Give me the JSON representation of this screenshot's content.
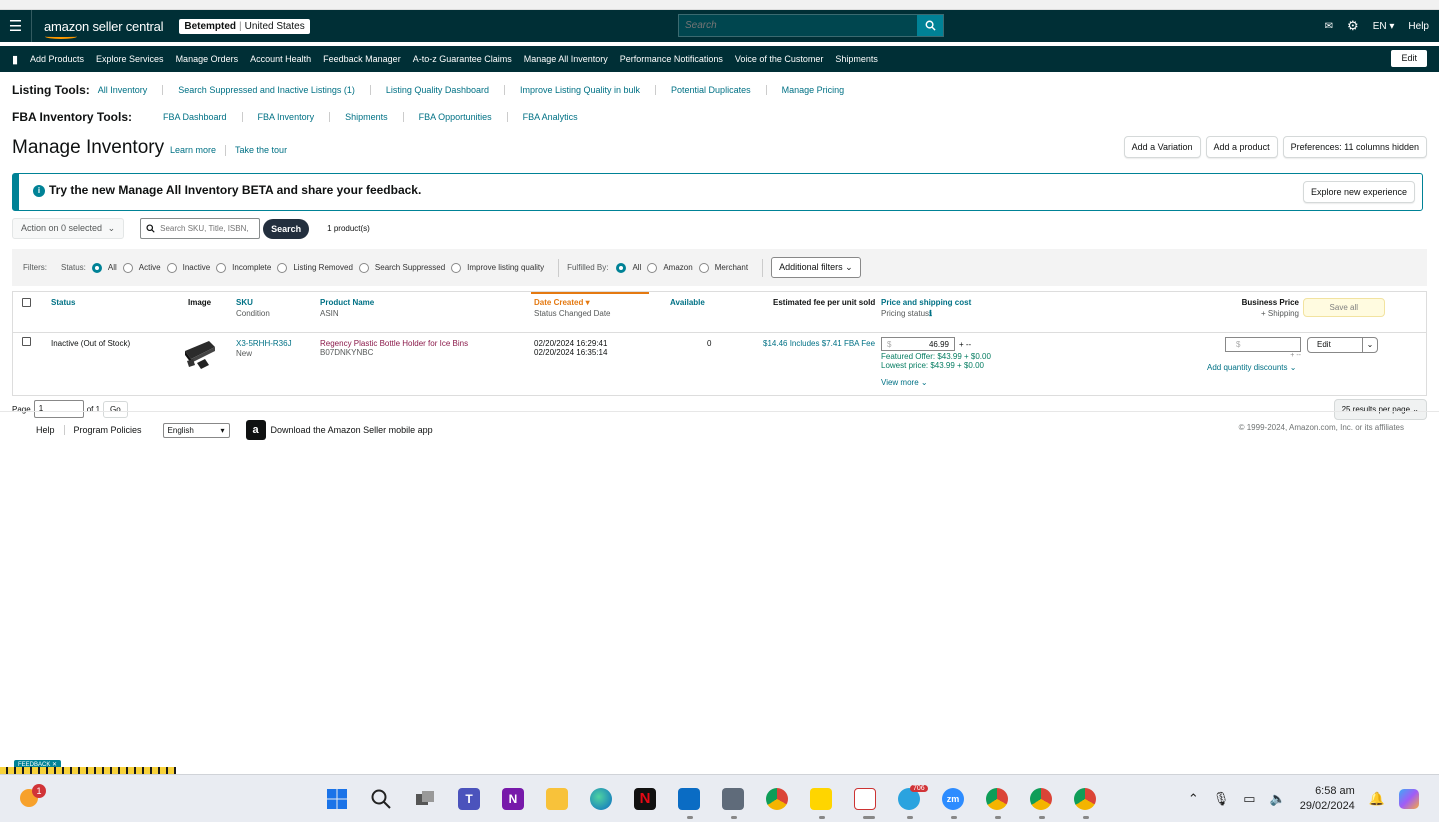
{
  "topbar": {
    "logo": "amazon seller central",
    "store_name": "Betempted",
    "store_region": "United States",
    "search_placeholder": "Search",
    "lang": "EN",
    "help": "Help"
  },
  "nav": {
    "items": [
      "Add Products",
      "Explore Services",
      "Manage Orders",
      "Account Health",
      "Feedback Manager",
      "A-to-z Guarantee Claims",
      "Manage All Inventory",
      "Performance Notifications",
      "Voice of the Customer",
      "Shipments"
    ],
    "edit": "Edit"
  },
  "listing_tools": {
    "title": "Listing Tools:",
    "links": [
      "All Inventory",
      "Search Suppressed and Inactive Listings (1)",
      "Listing Quality Dashboard",
      "Improve Listing Quality in bulk",
      "Potential Duplicates",
      "Manage Pricing"
    ]
  },
  "fba_tools": {
    "title": "FBA Inventory Tools:",
    "links": [
      "FBA Dashboard",
      "FBA Inventory",
      "Shipments",
      "FBA Opportunities",
      "FBA Analytics"
    ]
  },
  "page": {
    "title": "Manage Inventory",
    "learn_more": "Learn more",
    "take_tour": "Take the tour",
    "add_variation": "Add a Variation",
    "add_product": "Add a product",
    "preferences": "Preferences: 11 columns hidden"
  },
  "banner": {
    "icon": "i",
    "text": "Try the new Manage All Inventory BETA and share your feedback.",
    "button": "Explore new experience"
  },
  "actions": {
    "action_select": "Action on 0 selected",
    "search_placeholder": "Search SKU, Title, ISBN,",
    "search_button": "Search",
    "product_count": "1 product(s)"
  },
  "filters": {
    "label": "Filters:",
    "status_label": "Status:",
    "status_options": [
      "All",
      "Active",
      "Inactive",
      "Incomplete",
      "Listing Removed",
      "Search Suppressed",
      "Improve listing quality"
    ],
    "status_selected": "All",
    "fulfilled_label": "Fulfilled By:",
    "fulfilled_options": [
      "All",
      "Amazon",
      "Merchant"
    ],
    "fulfilled_selected": "All",
    "additional": "Additional filters"
  },
  "table": {
    "headers": {
      "status": "Status",
      "image": "Image",
      "sku": "SKU",
      "sku_sub": "Condition",
      "product_name": "Product Name",
      "product_sub": "ASIN",
      "date_created": "Date Created",
      "date_sub": "Status Changed Date",
      "available": "Available",
      "est_fee": "Estimated fee per unit sold",
      "price": "Price and shipping cost",
      "price_sub": "Pricing status",
      "business_price": "Business Price",
      "business_sub": "+ Shipping",
      "save_all": "Save all"
    },
    "rows": [
      {
        "status": "Inactive (Out of Stock)",
        "sku": "X3-5RHH-R36J",
        "condition": "New",
        "product_name": "Regency Plastic Bottle Holder for Ice Bins",
        "asin": "B07DNKYNBC",
        "date_created": "02/20/2024 16:29:41",
        "status_changed": "02/20/2024 16:35:14",
        "available": "0",
        "est_fee": "$14.46 Includes $7.41 FBA Fee",
        "price": "46.99",
        "price_currency": "$",
        "price_plus": "+ --",
        "featured_offer": "Featured Offer: $43.99 + $0.00",
        "lowest_price": "Lowest price: $43.99 + $0.00",
        "view_more": "View more",
        "business_currency": "$",
        "business_plus": "+ --",
        "add_quantity_discounts": "Add quantity discounts",
        "edit": "Edit"
      }
    ]
  },
  "pagination": {
    "page_label": "Page",
    "page_value": "1",
    "of_label": "of 1",
    "go": "Go",
    "results_per_page": "25 results per page"
  },
  "footer": {
    "help": "Help",
    "program_policies": "Program Policies",
    "language": "English",
    "app_icon": "a",
    "app_text": "Download the Amazon Seller mobile app",
    "copyright": "© 1999-2024, Amazon.com, Inc. or its affiliates"
  },
  "feedback": "FEEDBACK",
  "taskbar": {
    "weather_badge": "1",
    "telegram_badge": "706",
    "zoom_label": "zm",
    "time": "6:58 am",
    "date": "29/02/2024"
  }
}
